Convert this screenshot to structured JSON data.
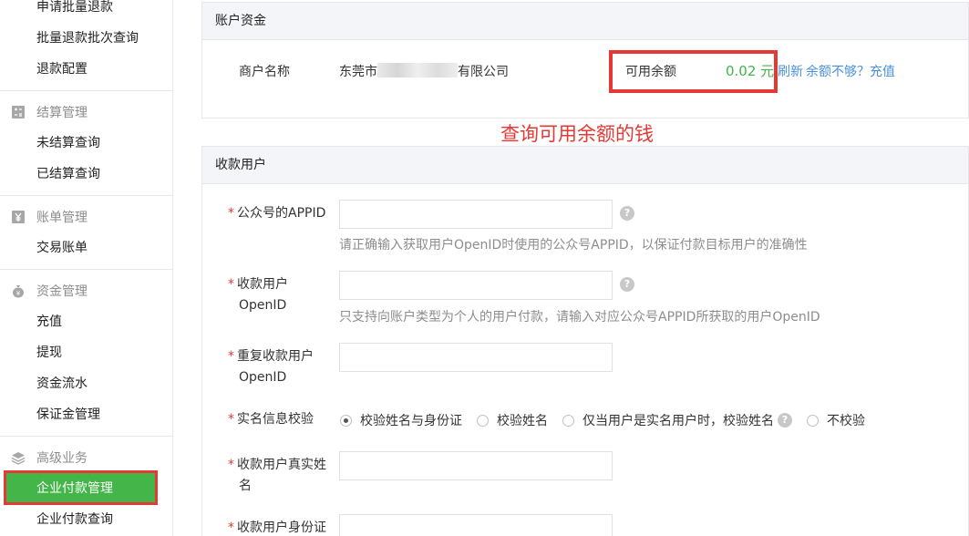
{
  "sidebar": {
    "items_top": [
      "申请批量退款",
      "批量退款批次查询",
      "退款配置"
    ],
    "groups": [
      {
        "title": "结算管理",
        "icon": "settlement-icon",
        "items": [
          "未结算查询",
          "已结算查询"
        ]
      },
      {
        "title": "账单管理",
        "icon": "yen-icon",
        "items": [
          "交易账单"
        ]
      },
      {
        "title": "资金管理",
        "icon": "money-bag-icon",
        "items": [
          "充值",
          "提现",
          "资金流水",
          "保证金管理"
        ]
      },
      {
        "title": "高级业务",
        "icon": "layers-icon",
        "items": [
          "企业付款管理",
          "企业付款查询"
        ]
      }
    ],
    "active_item": "企业付款管理"
  },
  "account_funds": {
    "title": "账户资金",
    "merchant_label": "商户名称",
    "merchant_prefix": "东莞市",
    "merchant_suffix": "有限公司",
    "balance_label": "可用余额",
    "balance_value": "0.02 元",
    "refresh_link": "刷新",
    "topup_link": "余额不够？充值"
  },
  "annotation": "查询可用余额的钱",
  "payee": {
    "title": "收款用户",
    "appid_label": "公众号的APPID",
    "appid_hint": "请正确输入获取用户OpenID时使用的公众号APPID，以保证付款目标用户的准确性",
    "openid_label_1": "收款用户",
    "openid_label_2": "OpenID",
    "openid_hint": "只支持向账户类型为个人的用户付款，请输入对应公众号APPID所获取的用户OpenID",
    "repeat_label_1": "重复收款用户",
    "repeat_label_2": "OpenID",
    "verify_label": "实名信息校验",
    "verify_options": [
      "校验姓名与身份证",
      "校验姓名",
      "仅当用户是实名用户时，校验姓名",
      "不校验"
    ],
    "verify_selected": "校验姓名与身份证",
    "realname_label_1": "收款用户真实姓",
    "realname_label_2": "名",
    "idcard_label": "收款用户身份证"
  },
  "colors": {
    "accent_green": "#44b549",
    "highlight_red": "#e53935",
    "link_blue": "#4a90d9"
  }
}
